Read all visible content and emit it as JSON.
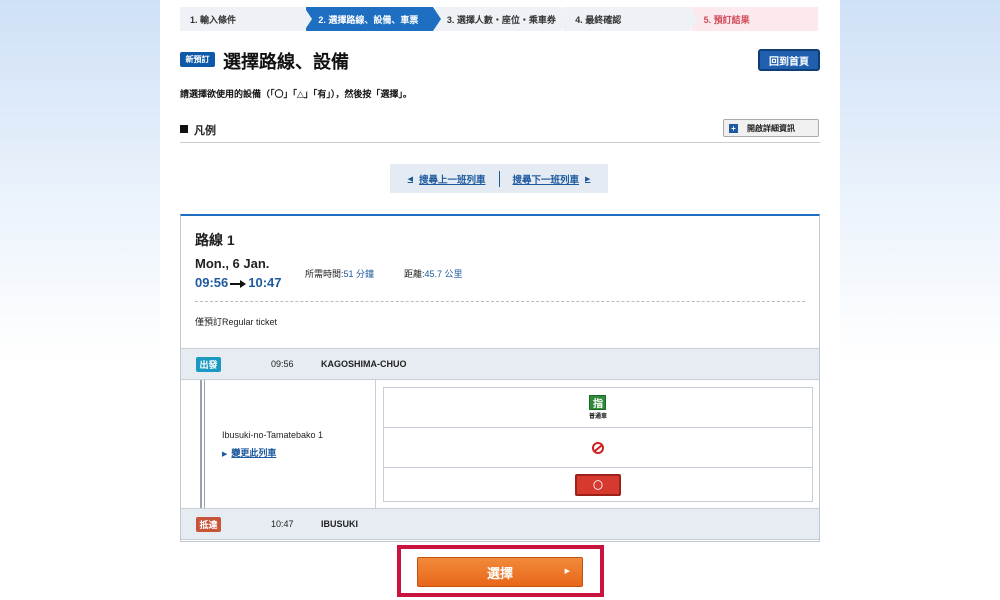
{
  "stepper": [
    {
      "label": "1.  輸入條件",
      "state": "done"
    },
    {
      "label": "2.  選擇路線、設備、車票",
      "state": "active"
    },
    {
      "label": "3.  選擇人數・座位・乘車券",
      "state": "todo"
    },
    {
      "label": "4.  最終確認",
      "state": "todo"
    },
    {
      "label": "5.  預訂結果",
      "state": "result"
    }
  ],
  "header": {
    "badge": "新預訂",
    "title": "選擇路線、設備",
    "home_button": "回到首頁",
    "instruction": "請選擇欲使用的設備（「〇」「△」「有」），然後按「選擇」。"
  },
  "legend": {
    "title": "凡例",
    "open_detail": "開啟詳細資訊",
    "plus_icon": "+"
  },
  "train_nav": {
    "prev_label": "搜尋上一班列車",
    "next_label": "搜尋下一班列車"
  },
  "route": {
    "title": "路線 1",
    "date": "Mon., 6 Jan.",
    "depart_time": "09:56",
    "arrive_time": "10:47",
    "duration_label": "所需時間:",
    "duration_value": "51 分鐘",
    "distance_label": "距離:",
    "distance_value": "45.7 公里",
    "ticket_note": "僅預訂Regular ticket",
    "departure": {
      "badge": "出發",
      "time": "09:56",
      "station": "KAGOSHIMA-CHUO"
    },
    "arrival": {
      "badge": "抵達",
      "time": "10:47",
      "station": "IBUSUKI"
    },
    "train": {
      "name": "Ibusuki-no-Tamatebako 1",
      "change_label": "變更此列車"
    },
    "seat": {
      "reserved_char": "指",
      "reserved_label": "普通車",
      "availability": "〇"
    }
  },
  "select_button": "選擇",
  "colors": {
    "accent": "#1e6fc2",
    "depart_badge": "#1a9ac0",
    "arrive_badge": "#c8543a",
    "select_button": "#e8671a",
    "highlight_frame": "#c8143f"
  }
}
